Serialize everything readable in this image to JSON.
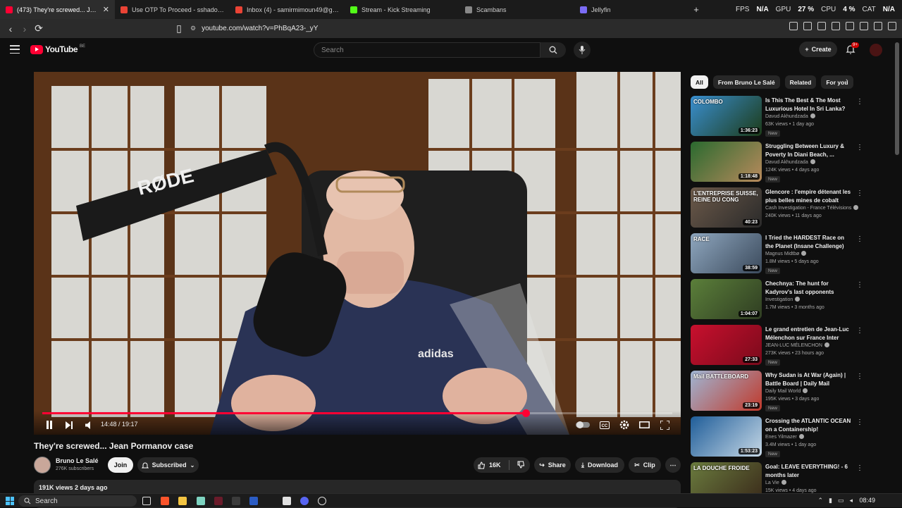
{
  "tabs": [
    {
      "title": "(473) They're screwed... Jean",
      "active": true,
      "color": "#ff0033"
    },
    {
      "title": "Use OTP To Proceed - sshadowmimo",
      "active": false,
      "color": "#ea4335"
    },
    {
      "title": "Inbox (4) - samirmimoun49@gmail.c",
      "active": false,
      "color": "#ea4335"
    },
    {
      "title": "Stream - Kick Streaming",
      "active": false,
      "color": "#53fc18"
    },
    {
      "title": "Scambans",
      "active": false,
      "color": "#888888"
    },
    {
      "title": "Jellyfin",
      "active": false,
      "color": "#7b6cf6"
    }
  ],
  "stats": {
    "fps_label": "FPS",
    "fps_value": "N/A",
    "gpu_label": "GPU",
    "gpu_value": "27 %",
    "cpu_label": "CPU",
    "cpu_value": "4 %",
    "cat_label": "CAT",
    "cat_value": "N/A"
  },
  "browser": {
    "url": "youtube.com/watch?v=PhBqA23-_yY"
  },
  "youtube": {
    "logo_text": "YouTube",
    "logo_country": "BE",
    "search_placeholder": "Search",
    "create_label": "Create",
    "notifications_badge": "9+"
  },
  "player": {
    "current_time": "14:48",
    "duration": "19:17",
    "time_display": "14:48 / 19:17",
    "progress_fraction": 0.767,
    "scene_text_mic": "RØDE",
    "scene_text_jacket": "adidas"
  },
  "video": {
    "title": "They're screwed... Jean Pormanov case",
    "channel": "Bruno Le Salé",
    "subscribers": "276K subscribers",
    "join_label": "Join",
    "subscribed_label": "Subscribed",
    "likes": "16K",
    "share_label": "Share",
    "download_label": "Download",
    "clip_label": "Clip",
    "views_date": "191K views  2 days ago"
  },
  "chips": [
    "All",
    "From Bruno Le Salé",
    "Related",
    "For you"
  ],
  "recommendations": [
    {
      "title": "Is This The Best & The Most Luxurious Hotel In Sri Lanka? ...",
      "channel": "Davud Akhundzada",
      "verified": true,
      "meta": "63K views • 1 day ago",
      "new": "New",
      "duration": "1:36:23",
      "thumb_text": "COLOMBO",
      "c1": "#3a8fd0",
      "c2": "#1c3b18"
    },
    {
      "title": "Struggling Between Luxury & Poverty In Diani Beach, ...",
      "channel": "Davud Akhundzada",
      "verified": true,
      "meta": "124K views • 4 days ago",
      "new": "New",
      "duration": "1:18:48",
      "thumb_text": "",
      "c1": "#2a6a2f",
      "c2": "#b88a5c"
    },
    {
      "title": "Glencore : l'empire détenant les plus belles mines de cobalt au...",
      "channel": "Cash Investigation - France Télévisions",
      "verified": true,
      "meta": "240K views • 11 days ago",
      "new": "",
      "duration": "40:23",
      "thumb_text": "L'ENTREPRISE SUISSE, REINE DU CONG",
      "c1": "#6d5a4a",
      "c2": "#2a2a2a"
    },
    {
      "title": "I Tried the HARDEST Race on the Planet (Insane Challenge)",
      "channel": "Magnus Midtbø",
      "verified": true,
      "meta": "1.8M views • 5 days ago",
      "new": "New",
      "duration": "38:59",
      "thumb_text": "RACE",
      "c1": "#8fa7bf",
      "c2": "#3b4a5c"
    },
    {
      "title": "Chechnya: The hunt for Kadyrov's last opponents",
      "channel": "Investigation",
      "verified": true,
      "meta": "1.7M views • 3 months ago",
      "new": "",
      "duration": "1:04:07",
      "thumb_text": "",
      "c1": "#5b7f3a",
      "c2": "#2f3d22"
    },
    {
      "title": "Le grand entretien de Jean-Luc Mélenchon sur France Inter",
      "channel": "JEAN-LUC MÉLENCHON",
      "verified": true,
      "meta": "273K views • 23 hours ago",
      "new": "New",
      "duration": "27:33",
      "thumb_text": "",
      "c1": "#c8102e",
      "c2": "#7a0a1b"
    },
    {
      "title": "Why Sudan is At War (Again) | Battle Board | Daily Mail",
      "channel": "Daily Mail World",
      "verified": true,
      "meta": "195K views • 3 days ago",
      "new": "New",
      "duration": "23:19",
      "thumb_text": "Mail BATTLEBOARD",
      "c1": "#9fb6d4",
      "c2": "#c0392b"
    },
    {
      "title": "Crossing the ATLANTIC OCEAN on a Containership!",
      "channel": "Enes Yilmazer",
      "verified": true,
      "meta": "3.4M views • 1 day ago",
      "new": "New",
      "duration": "1:53:23",
      "thumb_text": "",
      "c1": "#1f5d99",
      "c2": "#c6d8e6"
    },
    {
      "title": "Goal: LEAVE EVERYTHING! - 6 months later",
      "channel": "La Vie",
      "verified": true,
      "meta": "15K views • 4 days ago",
      "new": "",
      "duration": "53:08",
      "thumb_text": "LA DOUCHE FROIDE",
      "c1": "#6a7b3e",
      "c2": "#3a2a1a"
    }
  ],
  "taskbar": {
    "search_label": "Search",
    "time": "08:49"
  }
}
